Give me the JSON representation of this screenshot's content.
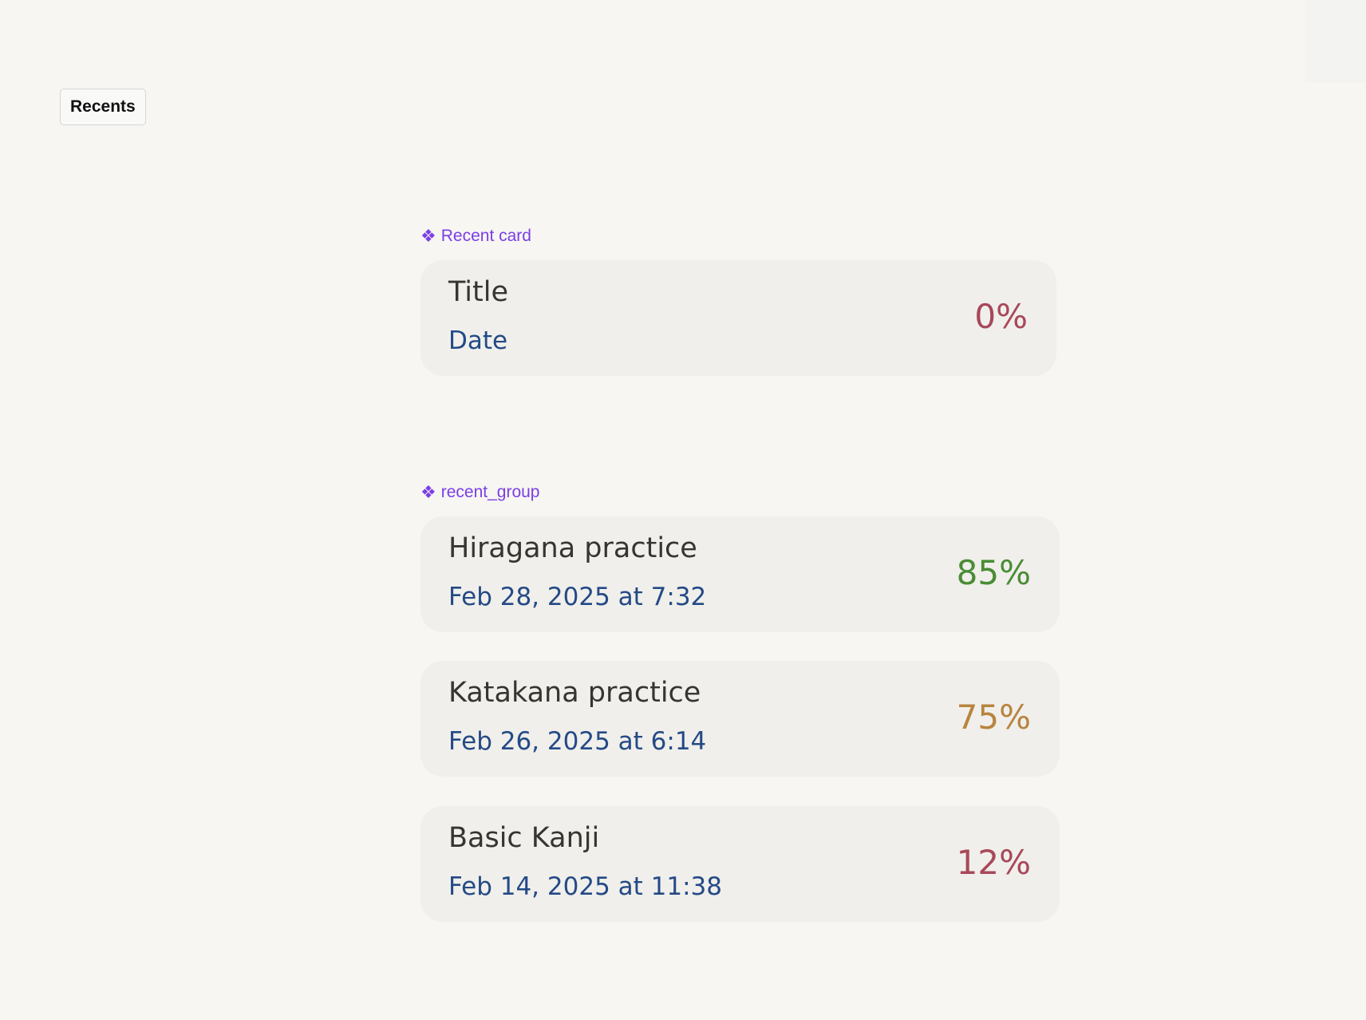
{
  "page": {
    "tab_label": "Recents"
  },
  "component": {
    "icon": "component-icon",
    "symbol": "❖",
    "name": "Recent card",
    "card": {
      "title": "Title",
      "date": "Date",
      "percent": "0%",
      "percent_value": 0,
      "percent_color": "#a8485a"
    }
  },
  "group": {
    "icon": "component-icon",
    "symbol": "❖",
    "name": "recent_group",
    "items": [
      {
        "title": "Hiragana practice",
        "date": "Feb 28, 2025 at 7:32",
        "percent": "85%",
        "percent_value": 85,
        "percent_color": "#4a8c35"
      },
      {
        "title": "Katakana practice",
        "date": "Feb 26, 2025 at 6:14",
        "percent": "75%",
        "percent_value": 75,
        "percent_color": "#b8843f"
      },
      {
        "title": "Basic Kanji",
        "date": "Feb 14, 2025 at 11:38",
        "percent": "12%",
        "percent_value": 12,
        "percent_color": "#a8485a"
      }
    ]
  },
  "colors": {
    "background": "#f7f6f3",
    "card_background": "#f0efeb",
    "title_text": "#37352f",
    "date_text": "#244a86",
    "component_label": "#7b3fe4"
  }
}
